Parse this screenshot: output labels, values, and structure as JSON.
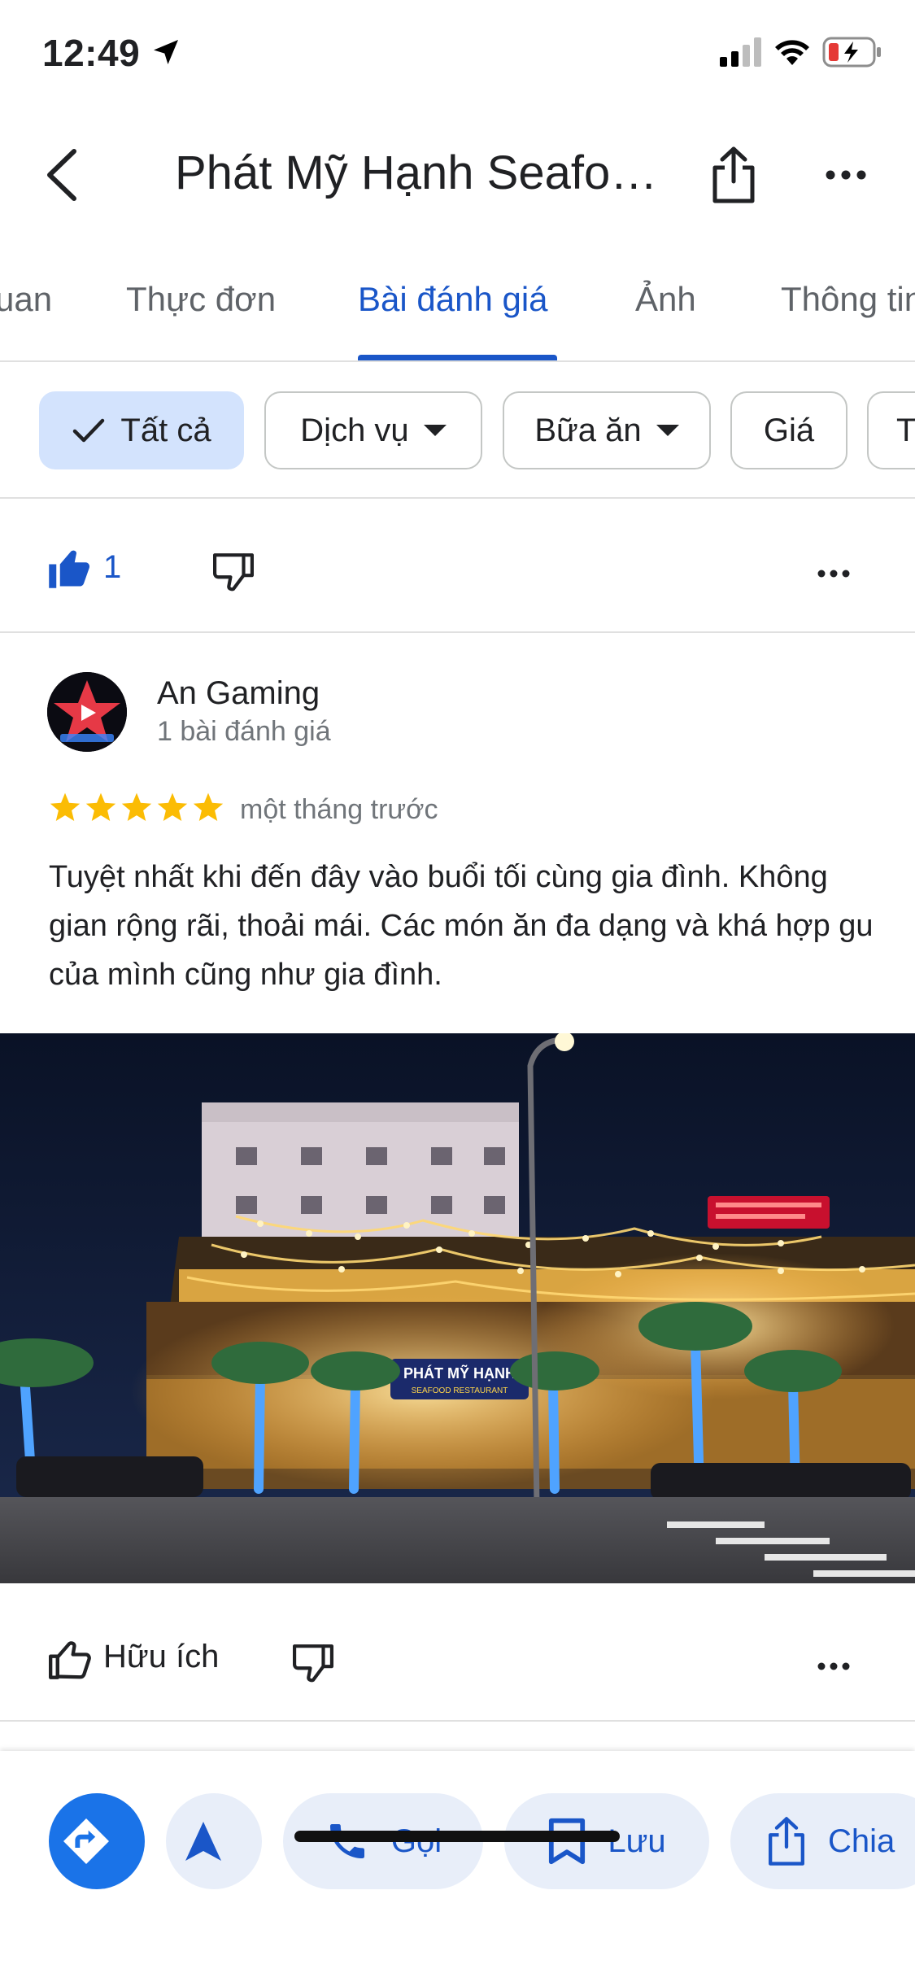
{
  "status_bar": {
    "time": "12:49"
  },
  "header": {
    "title": "Phát Mỹ Hạnh Seafo…"
  },
  "tabs": [
    {
      "label": "uan"
    },
    {
      "label": "Thực đơn"
    },
    {
      "label": "Bài đánh giá"
    },
    {
      "label": "Ảnh"
    },
    {
      "label": "Thông tin"
    }
  ],
  "active_tab": "Bài đánh giá",
  "filters": [
    {
      "label": "Tất cả",
      "selected": true
    },
    {
      "label": "Dịch vụ"
    },
    {
      "label": "Bữa ăn"
    },
    {
      "label": "Giá"
    },
    {
      "label": "T"
    }
  ],
  "previous_review": {
    "likes": "1"
  },
  "review": {
    "author": "An Gaming",
    "author_meta": "1 bài đánh giá",
    "rating": 5,
    "date": "một tháng trước",
    "text": "Tuyệt nhất khi đến đây vào buổi tối cùng gia đình. Không gian rộng rãi, thoải mái. Các món ăn đa dạng và khá hợp gu của mình cũng như gia đình.",
    "photo_sign": "PHÁT MỸ HẠNH",
    "photo_sub": "SEAFOOD RESTAURANT",
    "helpful_label": "Hữu ích"
  },
  "actions": [
    {
      "label": ""
    },
    {
      "label": ""
    },
    {
      "label": "Gọi"
    },
    {
      "label": "Lưu"
    },
    {
      "label": "Chia"
    }
  ],
  "colors": {
    "accent": "#1a56c8",
    "chip_selected": "#d3e3fd",
    "star": "#fbbc04",
    "action_bg": "#e8eef9"
  }
}
